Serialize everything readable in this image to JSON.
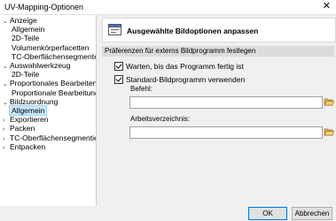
{
  "window": {
    "title": "UV-Mapping-Optionen",
    "close_glyph": "✕"
  },
  "tree": {
    "items": [
      {
        "label": "Anzeige",
        "expanded": true
      },
      {
        "label": "Allgemein"
      },
      {
        "label": "2D-Teile"
      },
      {
        "label": "Volumenkörperfacetten"
      },
      {
        "label": "TC-Oberflächensegmente"
      },
      {
        "label": "Auswahlwerkzeug",
        "expanded": true
      },
      {
        "label": "2D-Teile"
      },
      {
        "label": "Proportionales Bearbeiten von",
        "expanded": true
      },
      {
        "label": "Proportionale Bearbeitung"
      },
      {
        "label": "Bildzuordnung",
        "expanded": true
      },
      {
        "label": "Allgemein",
        "selected": true
      },
      {
        "label": "Exportieren",
        "expanded": false
      },
      {
        "label": "Packen",
        "expanded": false
      },
      {
        "label": "TC-Oberflächensegmentierung",
        "expanded": false
      },
      {
        "label": "Entpacken",
        "expanded": false
      }
    ],
    "expand_glyph": "›",
    "collapse_glyph": "⌄"
  },
  "panel": {
    "header_title": "Ausgewählte Bildoptionen anpassen",
    "header_icon": "settings-window-icon",
    "group_title": "Präferenzen für externs Bildprogramm festlegen",
    "wait_checkbox": {
      "label": "Warten, bis das Programm fertig ist",
      "checked": true
    },
    "default_program_checkbox": {
      "label": "Standard-Bildprogramm verwenden",
      "checked": true
    },
    "command": {
      "label": "Befehl:",
      "value": ""
    },
    "working_dir": {
      "label": "Arbeitsverzeichnis:",
      "value": ""
    },
    "browse_icon": "folder-open-icon"
  },
  "footer": {
    "ok_label": "OK",
    "cancel_label": "Abbrechen"
  },
  "colors": {
    "selection_bg": "#cde8ff",
    "selection_border": "#99d1ff",
    "default_button_border": "#0078d7",
    "folder_yellow": "#e8b14a"
  }
}
